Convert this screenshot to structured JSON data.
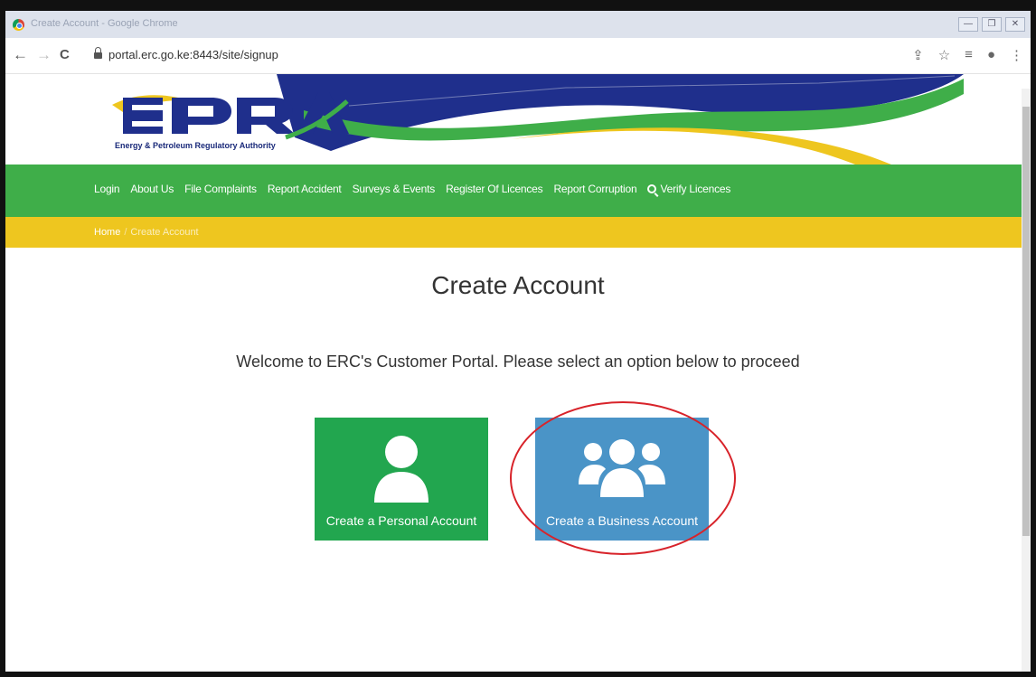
{
  "window": {
    "title": "Create Account - Google Chrome",
    "controls": [
      "—",
      "❐",
      "✕"
    ]
  },
  "browser": {
    "url": "portal.erc.go.ke:8443/site/signup",
    "back": "←",
    "forward": "→",
    "reload": "C"
  },
  "header": {
    "logo_text": "EPRA",
    "logo_tagline": "Energy & Petroleum Regulatory Authority"
  },
  "nav": {
    "items": [
      "Login",
      "About Us",
      "File Complaints",
      "Report Accident",
      "Surveys & Events",
      "Register Of Licences",
      "Report Corruption"
    ],
    "verify_label": "Verify Licences"
  },
  "breadcrumb": {
    "home": "Home",
    "separator": "/",
    "current": "Create Account"
  },
  "main": {
    "title": "Create Account",
    "welcome": "Welcome to ERC's Customer Portal. Please select an option below to proceed",
    "personal_label": "Create a Personal Account",
    "business_label": "Create a Business Account"
  },
  "colors": {
    "green_nav": "#3fae49",
    "yellow_bar": "#eec61f",
    "personal_card": "#22a64f",
    "business_card": "#4a94c7",
    "annotation": "#d8232a"
  }
}
